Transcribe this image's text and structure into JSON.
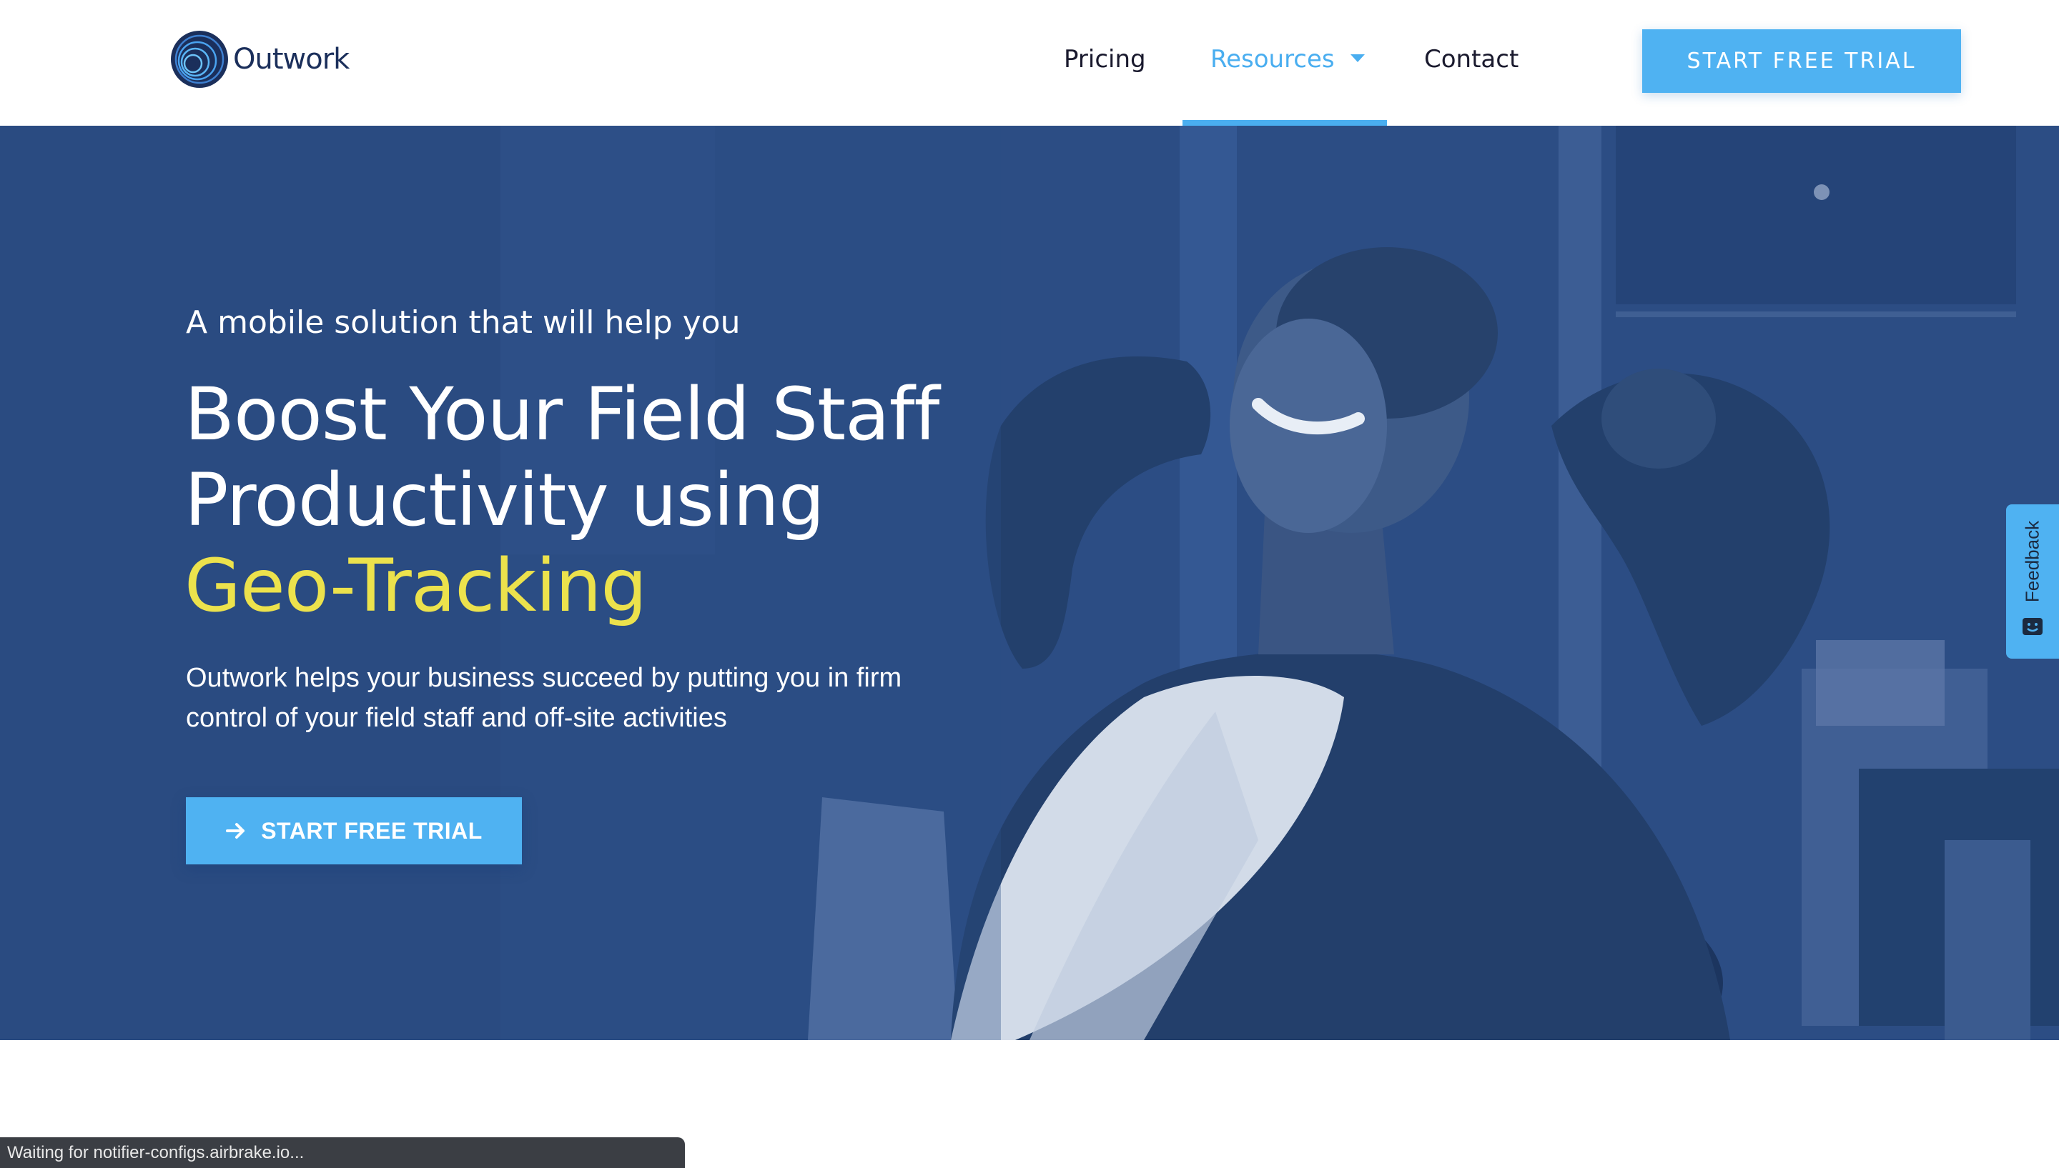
{
  "brand": {
    "name": "Outwork",
    "logo_icon": "swirl-logo-icon",
    "colors": {
      "primary_blue": "#4fb2f2",
      "navy": "#1b2f5b",
      "hero_overlay": "#2d4f86",
      "highlight_yellow": "#ece24c"
    }
  },
  "nav": {
    "items": [
      {
        "label": "Pricing"
      },
      {
        "label": "Resources",
        "active": true,
        "has_dropdown": true
      },
      {
        "label": "Contact"
      }
    ],
    "cta_label": "START FREE TRIAL"
  },
  "hero": {
    "subtitle": "A mobile solution that will help you",
    "title_line1": "Boost Your Field Staff",
    "title_line2": "Productivity using",
    "title_highlight": "Geo-Tracking",
    "description": "Outwork helps your business succeed by putting you in firm control of your field staff and off-site activities",
    "cta_label": "START FREE TRIAL",
    "cta_icon": "arrow-right-icon"
  },
  "feedback": {
    "label": "Feedback",
    "icon": "smile-face-icon"
  },
  "status_bar": {
    "text": "Waiting for notifier-configs.airbrake.io..."
  }
}
